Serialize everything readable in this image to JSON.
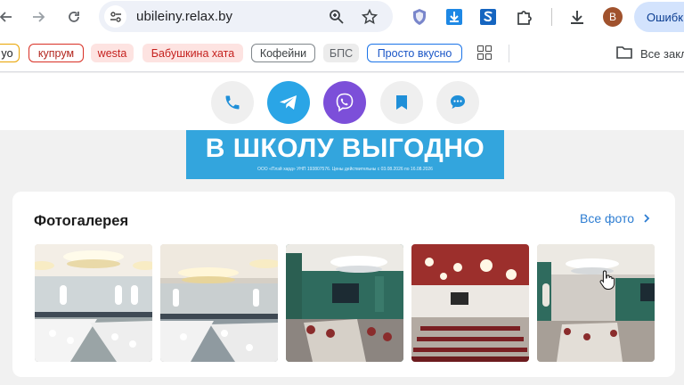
{
  "browser": {
    "url": "ubileiny.relax.by",
    "avatar_letter": "В",
    "error_button_label": "Ошибк"
  },
  "bookmarks": {
    "items": [
      {
        "label": "yo",
        "style": "orange"
      },
      {
        "label": "купрум",
        "style": "red-outline"
      },
      {
        "label": "westa",
        "style": "red-fill"
      },
      {
        "label": "Бабушкина хата",
        "style": "red-fill"
      },
      {
        "label": "Кофейни",
        "style": "gray-outline"
      },
      {
        "label": "БПС",
        "style": "gray-fill"
      },
      {
        "label": "Просто вкусно",
        "style": "blue-outline"
      }
    ],
    "all_bookmarks_label": "Все закл"
  },
  "contact_bar": {
    "buttons": [
      {
        "name": "phone-icon",
        "bg": "#efefef"
      },
      {
        "name": "telegram-icon",
        "bg": "#2aa5e6"
      },
      {
        "name": "viber-icon",
        "bg": "#7c4fd9"
      },
      {
        "name": "bookmark-icon",
        "bg": "#efefef"
      },
      {
        "name": "chat-icon",
        "bg": "#efefef"
      }
    ]
  },
  "banner": {
    "title": "В ШКОЛУ ВЫГОДНО",
    "subtitle": "ООО «Плэй хард» УНП 193807576. Цены действительны с 03.08.2026 по 16.08.2026"
  },
  "gallery": {
    "title": "Фотогалерея",
    "all_photos_label": "Все фото",
    "photos": [
      {
        "scene": "banquet-hall-white-1"
      },
      {
        "scene": "banquet-hall-white-2"
      },
      {
        "scene": "green-hall"
      },
      {
        "scene": "red-conference-hall"
      },
      {
        "scene": "green-hall-2"
      }
    ]
  },
  "colors": {
    "accent_blue": "#2d7dd2",
    "telegram": "#2aa5e6",
    "viber": "#7c4fd9",
    "banner": "#33a5dd"
  }
}
